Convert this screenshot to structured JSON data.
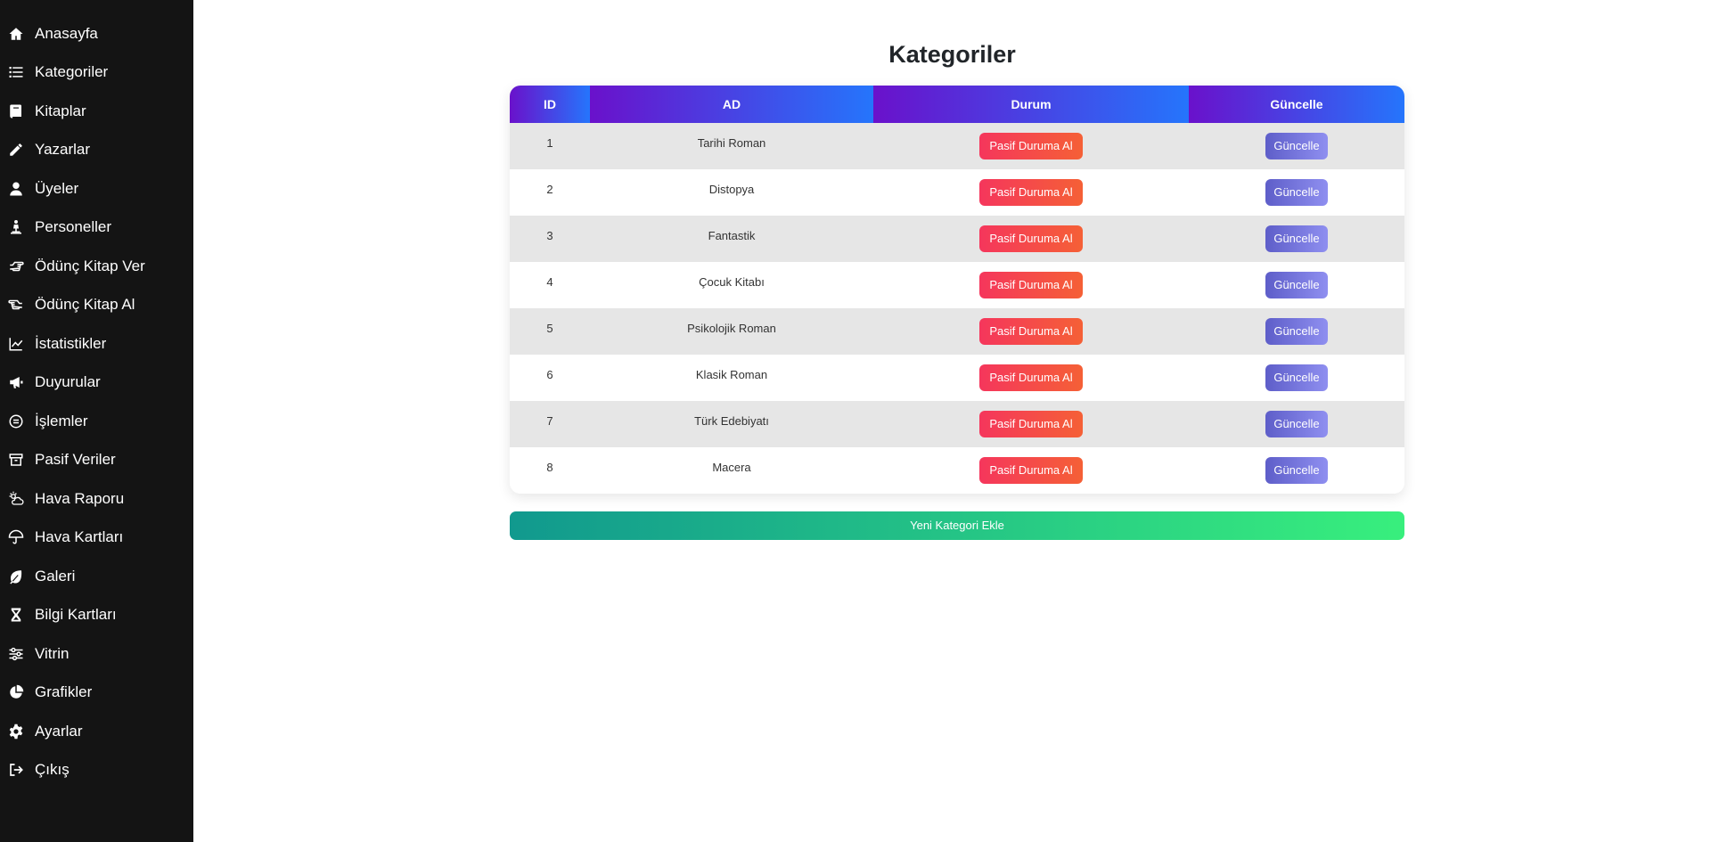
{
  "sidebar": {
    "items": [
      {
        "label": "Anasayfa",
        "icon": "home-icon"
      },
      {
        "label": "Kategoriler",
        "icon": "list-icon"
      },
      {
        "label": "Kitaplar",
        "icon": "book-icon"
      },
      {
        "label": "Yazarlar",
        "icon": "pencil-icon"
      },
      {
        "label": "Üyeler",
        "icon": "user-icon"
      },
      {
        "label": "Personeller",
        "icon": "person-desk-icon"
      },
      {
        "label": "Ödünç Kitap Ver",
        "icon": "hand-point-right-icon"
      },
      {
        "label": "Ödünç Kitap Al",
        "icon": "hand-point-left-icon"
      },
      {
        "label": "İstatistikler",
        "icon": "chart-line-icon"
      },
      {
        "label": "Duyurular",
        "icon": "megaphone-icon"
      },
      {
        "label": "İşlemler",
        "icon": "circle-equals-icon"
      },
      {
        "label": "Pasif Veriler",
        "icon": "archive-box-icon"
      },
      {
        "label": "Hava Raporu",
        "icon": "cloud-sun-icon"
      },
      {
        "label": "Hava Kartları",
        "icon": "umbrella-icon"
      },
      {
        "label": "Galeri",
        "icon": "leaf-icon"
      },
      {
        "label": "Bilgi Kartları",
        "icon": "hourglass-icon"
      },
      {
        "label": "Vitrin",
        "icon": "sliders-icon"
      },
      {
        "label": "Grafikler",
        "icon": "chart-pie-icon"
      },
      {
        "label": "Ayarlar",
        "icon": "gear-icon"
      },
      {
        "label": "Çıkış",
        "icon": "sign-out-icon"
      }
    ]
  },
  "page": {
    "title": "Kategoriler",
    "add_button": "Yeni Kategori Ekle"
  },
  "table": {
    "headers": [
      "ID",
      "AD",
      "Durum",
      "Güncelle"
    ],
    "rows": [
      {
        "id": "1",
        "ad": "Tarihi Roman",
        "durum": "Pasif Duruma Al",
        "guncelle": "Güncelle"
      },
      {
        "id": "2",
        "ad": "Distopya",
        "durum": "Pasif Duruma Al",
        "guncelle": "Güncelle"
      },
      {
        "id": "3",
        "ad": "Fantastik",
        "durum": "Pasif Duruma Al",
        "guncelle": "Güncelle"
      },
      {
        "id": "4",
        "ad": "Çocuk Kitabı",
        "durum": "Pasif Duruma Al",
        "guncelle": "Güncelle"
      },
      {
        "id": "5",
        "ad": "Psikolojik Roman",
        "durum": "Pasif Duruma Al",
        "guncelle": "Güncelle"
      },
      {
        "id": "6",
        "ad": "Klasik Roman",
        "durum": "Pasif Duruma Al",
        "guncelle": "Güncelle"
      },
      {
        "id": "7",
        "ad": "Türk Edebiyatı",
        "durum": "Pasif Duruma Al",
        "guncelle": "Güncelle"
      },
      {
        "id": "8",
        "ad": "Macera",
        "durum": "Pasif Duruma Al",
        "guncelle": "Güncelle"
      }
    ]
  },
  "colors": {
    "sidebar_bg": "#141414",
    "header_gradient_start": "#6a11cb",
    "header_gradient_end": "#2575fc",
    "danger_start": "#f5365c",
    "danger_end": "#f56036",
    "update_start": "#5e5ec9",
    "update_end": "#8f8ff0",
    "add_start": "#11998e",
    "add_end": "#38ef7d"
  }
}
